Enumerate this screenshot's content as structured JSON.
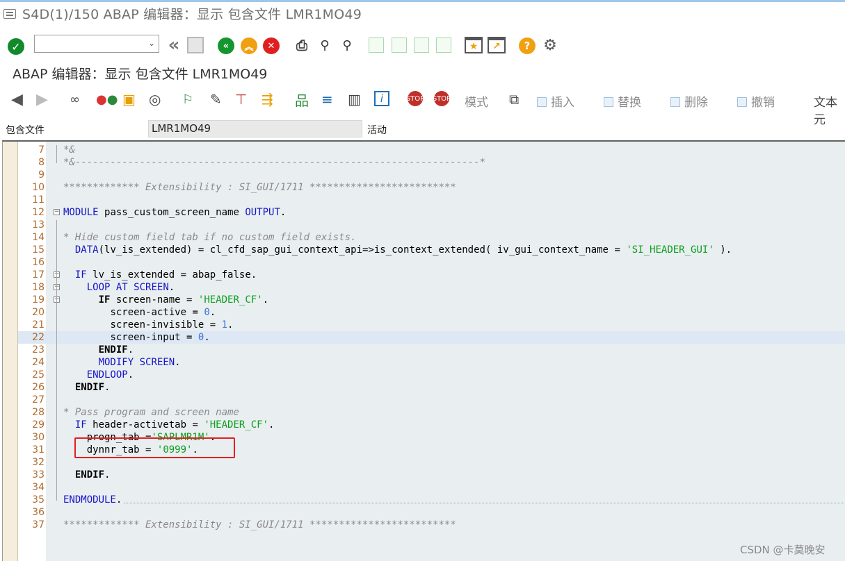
{
  "window": {
    "title": "S4D(1)/150 ABAP 编辑器：显示 包含文件 LMR1MO49"
  },
  "system_toolbar": {
    "command_field_value": ""
  },
  "screen": {
    "title": "ABAP 编辑器：显示 包含文件 LMR1MO49"
  },
  "app_toolbar": {
    "mode_label": "模式",
    "insert_label": "插入",
    "replace_label": "替换",
    "delete_label": "删除",
    "undo_label": "撤销",
    "text_label": "文本元"
  },
  "include": {
    "label": "包含文件",
    "value": "LMR1MO49",
    "status": "活动"
  },
  "editor": {
    "lines": [
      {
        "n": "7",
        "text": "*&"
      },
      {
        "n": "8",
        "text": "*&---------------------------------------------------------------------*"
      },
      {
        "n": "9",
        "text": ""
      },
      {
        "n": "10",
        "text": "************* Extensibility : SI_GUI/1711 *************************"
      },
      {
        "n": "11",
        "text": ""
      },
      {
        "n": "12",
        "text": "MODULE pass_custom_screen_name OUTPUT."
      },
      {
        "n": "13",
        "text": ""
      },
      {
        "n": "14",
        "text": "* Hide custom field tab if no custom field exists."
      },
      {
        "n": "15",
        "text": "  DATA(lv_is_extended) = cl_cfd_sap_gui_context_api=>is_context_extended( iv_gui_context_name = 'SI_HEADER_GUI' )."
      },
      {
        "n": "16",
        "text": ""
      },
      {
        "n": "17",
        "text": "  IF lv_is_extended = abap_false."
      },
      {
        "n": "18",
        "text": "    LOOP AT SCREEN."
      },
      {
        "n": "19",
        "text": "      IF screen-name = 'HEADER_CF'."
      },
      {
        "n": "20",
        "text": "        screen-active = 0."
      },
      {
        "n": "21",
        "text": "        screen-invisible = 1."
      },
      {
        "n": "22",
        "text": "        screen-input = 0."
      },
      {
        "n": "23",
        "text": "      ENDIF."
      },
      {
        "n": "24",
        "text": "      MODIFY SCREEN."
      },
      {
        "n": "25",
        "text": "    ENDLOOP."
      },
      {
        "n": "26",
        "text": "  ENDIF."
      },
      {
        "n": "27",
        "text": ""
      },
      {
        "n": "28",
        "text": "* Pass program and screen name"
      },
      {
        "n": "29",
        "text": "  IF header-activetab = 'HEADER_CF'."
      },
      {
        "n": "30",
        "text": "    progn_tab ='SAPLMR1M'."
      },
      {
        "n": "31",
        "text": "    dynnr_tab = '0999'."
      },
      {
        "n": "32",
        "text": ""
      },
      {
        "n": "33",
        "text": "  ENDIF."
      },
      {
        "n": "34",
        "text": ""
      },
      {
        "n": "35",
        "text": "ENDMODULE."
      },
      {
        "n": "36",
        "text": ""
      },
      {
        "n": "37",
        "text": "************* Extensibility : SI_GUI/1711 *************************"
      }
    ]
  },
  "watermark": "CSDN @卡莫晚安",
  "colors": {
    "keyword": "#1414c8",
    "string": "#0a9d1c",
    "number": "#3a74d8",
    "comment": "#8a8a8a",
    "line_number": "#b06b2f",
    "highlight_line": "#dde8f4",
    "editor_bg": "#e9eef0",
    "annotation_box": "#e22020"
  }
}
